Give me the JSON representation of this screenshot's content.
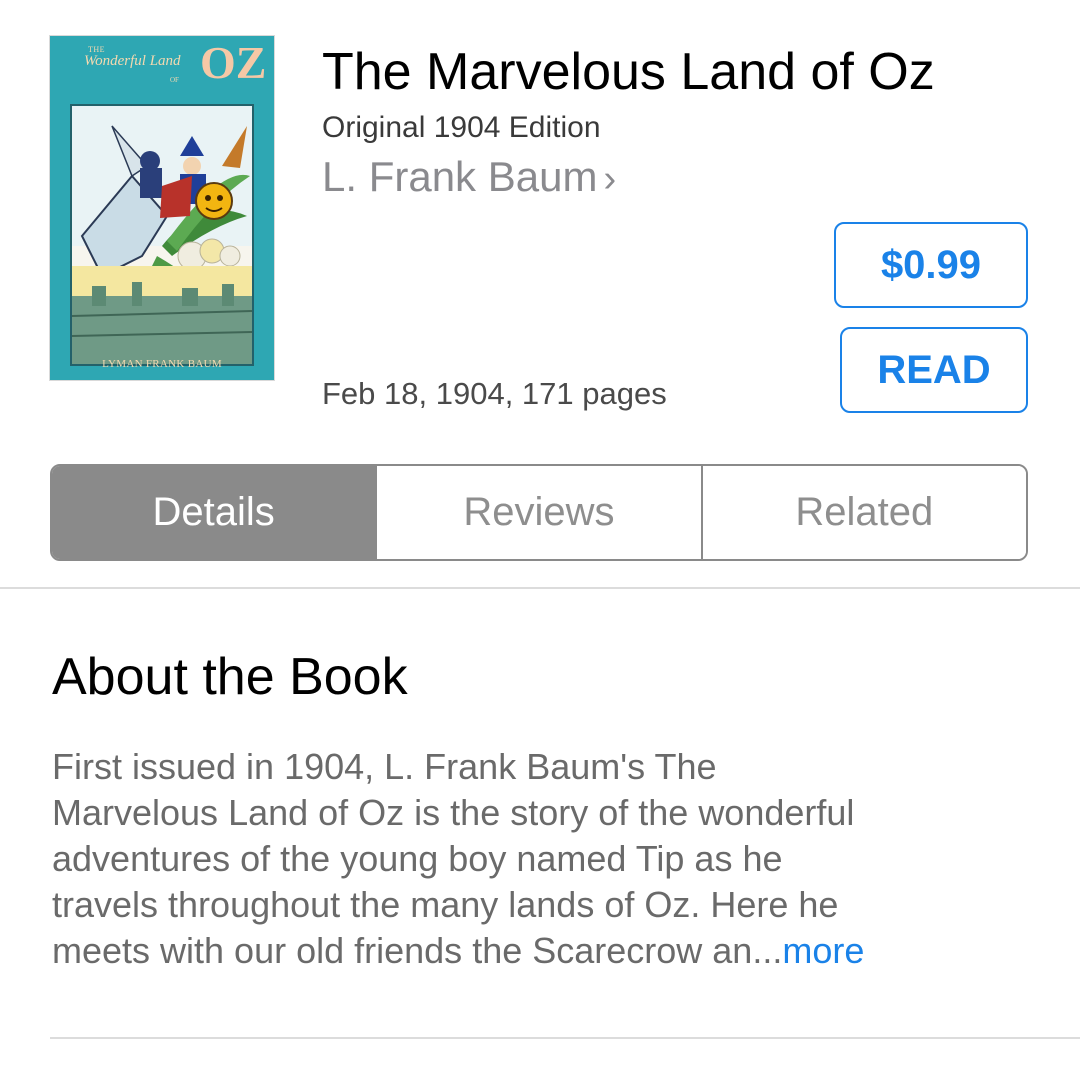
{
  "book": {
    "title": "The Marvelous Land of Oz",
    "subtitle": "Original 1904 Edition",
    "author": "L. Frank Baum",
    "publication_info": "Feb 18, 1904, 171 pages",
    "cover": {
      "title_the": "THE",
      "title_script": "Wonderful Land",
      "title_of": "OF",
      "title_oz": "OZ",
      "author_text": "LYMAN FRANK BAUM",
      "background_color": "#2ea7b3"
    }
  },
  "actions": {
    "price_label": "$0.99",
    "read_label": "READ",
    "accent_color": "#1a82e8"
  },
  "tabs": [
    {
      "label": "Details",
      "selected": true
    },
    {
      "label": "Reviews",
      "selected": false
    },
    {
      "label": "Related",
      "selected": false
    }
  ],
  "about": {
    "heading": "About the Book",
    "lines": [
      "First issued in 1904, L. Frank Baum's The",
      "Marvelous Land of Oz is the story of the wonderful",
      "adventures of the young boy named Tip as he",
      "travels throughout the many lands of Oz. Here he",
      "meets with our old friends the Scarecrow an..."
    ],
    "more_label": "more"
  },
  "icons": {
    "author_chevron": "chevron-right-icon"
  }
}
